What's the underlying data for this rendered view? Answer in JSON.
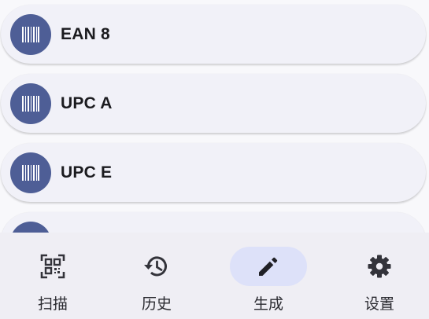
{
  "accent_color": "#4e5e96",
  "active_pill_color": "#dde1f9",
  "list": {
    "items": [
      {
        "label": "EAN 8",
        "icon": "barcode-icon"
      },
      {
        "label": "UPC A",
        "icon": "barcode-icon"
      },
      {
        "label": "UPC E",
        "icon": "barcode-icon"
      },
      {
        "label": "",
        "icon": "barcode-icon"
      }
    ]
  },
  "bottom_nav": {
    "active": "generate",
    "items": [
      {
        "id": "scan",
        "label": "扫描",
        "icon": "qr-scan-icon"
      },
      {
        "id": "history",
        "label": "历史",
        "icon": "history-icon"
      },
      {
        "id": "generate",
        "label": "生成",
        "icon": "pencil-icon"
      },
      {
        "id": "settings",
        "label": "设置",
        "icon": "gear-icon"
      }
    ]
  }
}
